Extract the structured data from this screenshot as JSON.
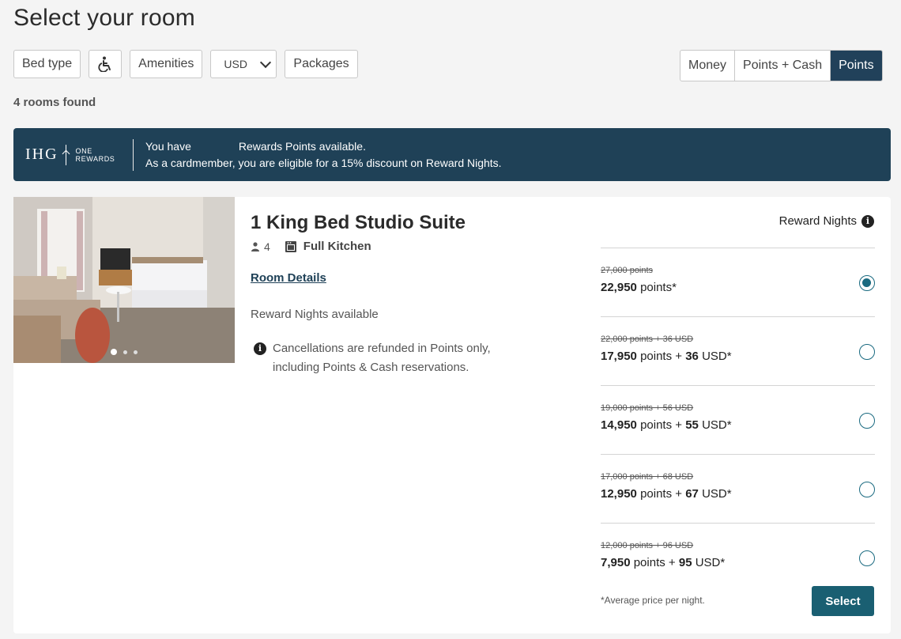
{
  "page": {
    "title": "Select your room",
    "rooms_found": "4 rooms found"
  },
  "filters": {
    "bed_type": "Bed type",
    "accessibility_icon": "wheelchair-icon",
    "amenities": "Amenities",
    "currency": "USD",
    "packages": "Packages"
  },
  "payment": {
    "options": [
      "Money",
      "Points + Cash",
      "Points"
    ],
    "selected": "Points"
  },
  "banner": {
    "logo_brand": "IHG",
    "logo_sub_1": "ONE",
    "logo_sub_2": "REWARDS",
    "line1_pre": "You have",
    "line1_post": "Rewards Points available.",
    "line2": "As a cardmember, you are eligible for a 15% discount on Reward Nights."
  },
  "room": {
    "name": "1 King Bed Studio Suite",
    "guests": "4",
    "kitchen": "Full Kitchen",
    "details_link": "Room Details",
    "reward_avail": "Reward Nights available",
    "cancel_note": "Cancellations are refunded in Points only, including Points & Cash reservations.",
    "photo_index": 1,
    "photo_count": 3
  },
  "rates": {
    "header": "Reward Nights",
    "items": [
      {
        "old": "27,000 points",
        "points": "22,950",
        "pts_label": "points",
        "cash": "",
        "cash_label": "",
        "suffix": "points*",
        "checked": true
      },
      {
        "old": "22,000 points + 36 USD",
        "points": "17,950",
        "pts_label": "points",
        "plus": "+",
        "cash": "36",
        "cash_label": "USD*",
        "checked": false
      },
      {
        "old": "19,000 points + 56 USD",
        "points": "14,950",
        "pts_label": "points",
        "plus": "+",
        "cash": "55",
        "cash_label": "USD*",
        "checked": false
      },
      {
        "old": "17,000 points + 68 USD",
        "points": "12,950",
        "pts_label": "points",
        "plus": "+",
        "cash": "67",
        "cash_label": "USD*",
        "checked": false
      },
      {
        "old": "12,000 points + 96 USD",
        "points": "7,950",
        "pts_label": "points",
        "plus": "+",
        "cash": "95",
        "cash_label": "USD*",
        "checked": false
      }
    ],
    "avg_note": "*Average price per night.",
    "select_label": "Select"
  },
  "colors": {
    "navy": "#21415a",
    "teal": "#1a5f72",
    "radio": "#1a6a80"
  }
}
